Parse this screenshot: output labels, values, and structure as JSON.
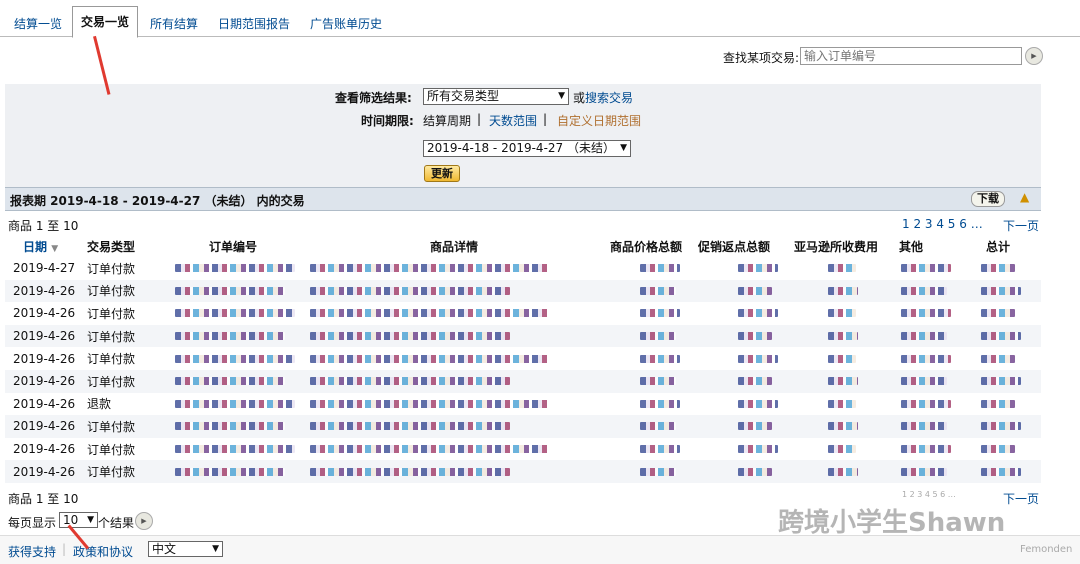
{
  "tabs": [
    "结算一览",
    "交易一览",
    "所有结算",
    "日期范围报告",
    "广告账单历史"
  ],
  "search": {
    "label": "查找某项交易:",
    "placeholder": "输入订单编号",
    "go_icon": "go-button-icon"
  },
  "filter": {
    "view_label": "查看筛选结果:",
    "type_value": "所有交易类型",
    "or_text": "或",
    "search_link": "搜索交易",
    "period_label": "时间期限:",
    "period_opt1": "结算周期",
    "sep": "|",
    "period_opt2": "天数范围",
    "period_opt3": "自定义日期范围",
    "date_value": "2019-4-18 - 2019-4-27 （未结）",
    "update_button": "更新"
  },
  "period_bar": {
    "title": "报表期 2019-4-18 - 2019-4-27 （未结） 内的交易",
    "download": "下载"
  },
  "pagination": {
    "range": "商品 1 至 10",
    "pages": "1 2 3 4 5 6 …",
    "next": "下一页"
  },
  "table": {
    "headers": [
      "日期",
      "交易类型",
      "订单编号",
      "商品详情",
      "商品价格总额",
      "促销返点总额",
      "亚马逊所收费用",
      "其他",
      "总计"
    ],
    "rows": [
      {
        "date": "2019-4-27",
        "type": "订单付款"
      },
      {
        "date": "2019-4-26",
        "type": "订单付款"
      },
      {
        "date": "2019-4-26",
        "type": "订单付款"
      },
      {
        "date": "2019-4-26",
        "type": "订单付款"
      },
      {
        "date": "2019-4-26",
        "type": "订单付款"
      },
      {
        "date": "2019-4-26",
        "type": "订单付款"
      },
      {
        "date": "2019-4-26",
        "type": "退款"
      },
      {
        "date": "2019-4-26",
        "type": "订单付款"
      },
      {
        "date": "2019-4-26",
        "type": "订单付款"
      },
      {
        "date": "2019-4-26",
        "type": "订单付款"
      }
    ]
  },
  "footer": {
    "per_page_label": "每页显示",
    "per_page_value": "10",
    "results_label": "个结果"
  },
  "bottom": {
    "support": "获得支持",
    "policy": "政策和协议",
    "language": "中文",
    "brand": "Femonden"
  },
  "watermark": "跨境小学生Shawn",
  "colors": {
    "link": "#004b91",
    "filter_bg": "#eef0f3",
    "annotation_arrow": "#e03a30"
  }
}
